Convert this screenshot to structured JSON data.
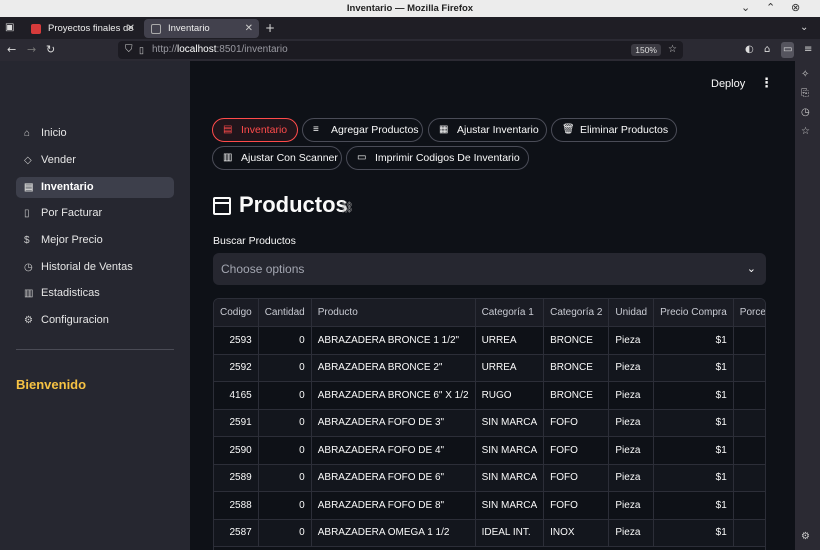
{
  "window": {
    "title": "Inventario — Mozilla Firefox"
  },
  "tabs": [
    {
      "label": "Proyectos finales de",
      "active": false
    },
    {
      "label": "Inventario",
      "active": true
    }
  ],
  "address": {
    "protocol": "http://",
    "host": "localhost",
    "path": ":8501/inventario",
    "zoom": "150%"
  },
  "header": {
    "deploy_label": "Deploy"
  },
  "sidebar": {
    "items": [
      {
        "label": "Inicio",
        "icon": "home-icon"
      },
      {
        "label": "Vender",
        "icon": "tag-icon"
      },
      {
        "label": "Inventario",
        "icon": "archive-icon",
        "active": true
      },
      {
        "label": "Por Facturar",
        "icon": "document-icon"
      },
      {
        "label": "Mejor Precio",
        "icon": "price-icon"
      },
      {
        "label": "Historial de Ventas",
        "icon": "history-icon"
      },
      {
        "label": "Estadisticas",
        "icon": "chart-icon"
      },
      {
        "label": "Configuracion",
        "icon": "gear-icon"
      }
    ],
    "welcome": "Bienvenido"
  },
  "actions": [
    {
      "label": "Inventario",
      "active": true
    },
    {
      "label": "Agregar Productos"
    },
    {
      "label": "Ajustar Inventario"
    },
    {
      "label": "Eliminar Productos"
    },
    {
      "label": "Ajustar Con Scanner"
    },
    {
      "label": "Imprimir Codigos De Inventario"
    }
  ],
  "page": {
    "title": "Productos"
  },
  "search": {
    "label": "Buscar Productos",
    "placeholder": "Choose options"
  },
  "table": {
    "columns": [
      "Codigo",
      "Cantidad",
      "Producto",
      "Categoría 1",
      "Categoría 2",
      "Unidad",
      "Precio Compra",
      "Porce"
    ],
    "rows": [
      [
        "2593",
        "0",
        "ABRAZADERA BRONCE 1 1/2\"",
        "URREA",
        "BRONCE",
        "Pieza",
        "$1",
        ""
      ],
      [
        "2592",
        "0",
        "ABRAZADERA BRONCE 2\"",
        "URREA",
        "BRONCE",
        "Pieza",
        "$1",
        ""
      ],
      [
        "4165",
        "0",
        "ABRAZADERA BRONCE 6\" X 1/2",
        "RUGO",
        "BRONCE",
        "Pieza",
        "$1",
        ""
      ],
      [
        "2591",
        "0",
        "ABRAZADERA FOFO DE 3\"",
        "SIN MARCA",
        "FOFO",
        "Pieza",
        "$1",
        ""
      ],
      [
        "2590",
        "0",
        "ABRAZADERA FOFO DE 4\"",
        "SIN MARCA",
        "FOFO",
        "Pieza",
        "$1",
        ""
      ],
      [
        "2589",
        "0",
        "ABRAZADERA FOFO DE 6\"",
        "SIN MARCA",
        "FOFO",
        "Pieza",
        "$1",
        ""
      ],
      [
        "2588",
        "0",
        "ABRAZADERA FOFO DE 8\"",
        "SIN MARCA",
        "FOFO",
        "Pieza",
        "$1",
        ""
      ],
      [
        "2587",
        "0",
        "ABRAZADERA OMEGA 1 1/2",
        "IDEAL INT.",
        "INOX",
        "Pieza",
        "$1",
        ""
      ]
    ]
  },
  "colors": {
    "accent": "#ff4b4b",
    "welcome": "#f6c243",
    "sidebar_bg": "#262730",
    "main_bg": "#0e1117"
  }
}
